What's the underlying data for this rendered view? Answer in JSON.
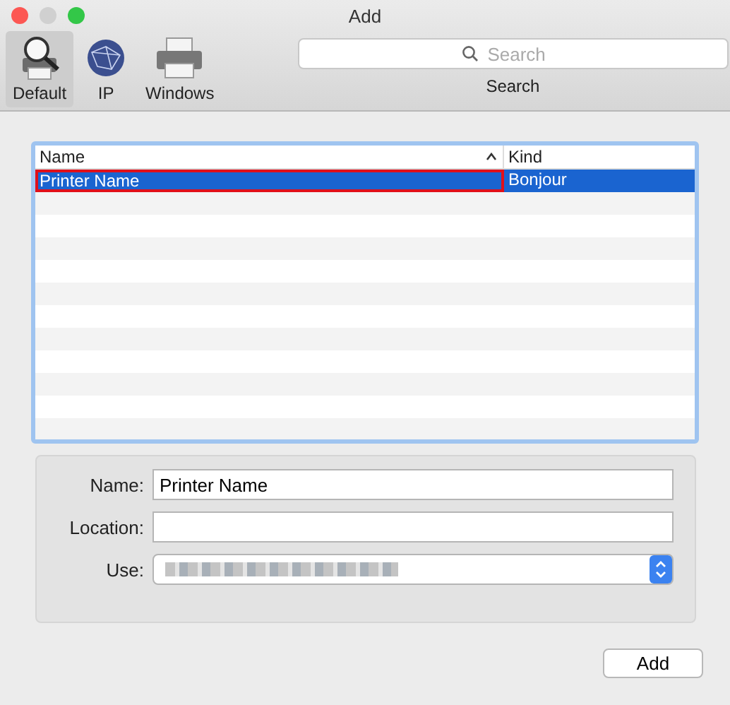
{
  "window": {
    "title": "Add"
  },
  "toolbar": {
    "items": [
      {
        "label": "Default",
        "kind": "default",
        "selected": true
      },
      {
        "label": "IP",
        "kind": "ip",
        "selected": false
      },
      {
        "label": "Windows",
        "kind": "windows",
        "selected": false
      }
    ]
  },
  "search": {
    "placeholder": "Search",
    "label": "Search"
  },
  "table": {
    "columns": [
      {
        "label": "Name",
        "sorted": true
      },
      {
        "label": "Kind",
        "sorted": false
      }
    ],
    "rows": [
      {
        "name": "Printer Name",
        "kind": "Bonjour",
        "selected": true,
        "highlighted": true
      }
    ]
  },
  "form": {
    "name_label": "Name:",
    "name_value": "Printer Name",
    "location_label": "Location:",
    "use_label": "Use:"
  },
  "buttons": [
    "Add"
  ]
}
